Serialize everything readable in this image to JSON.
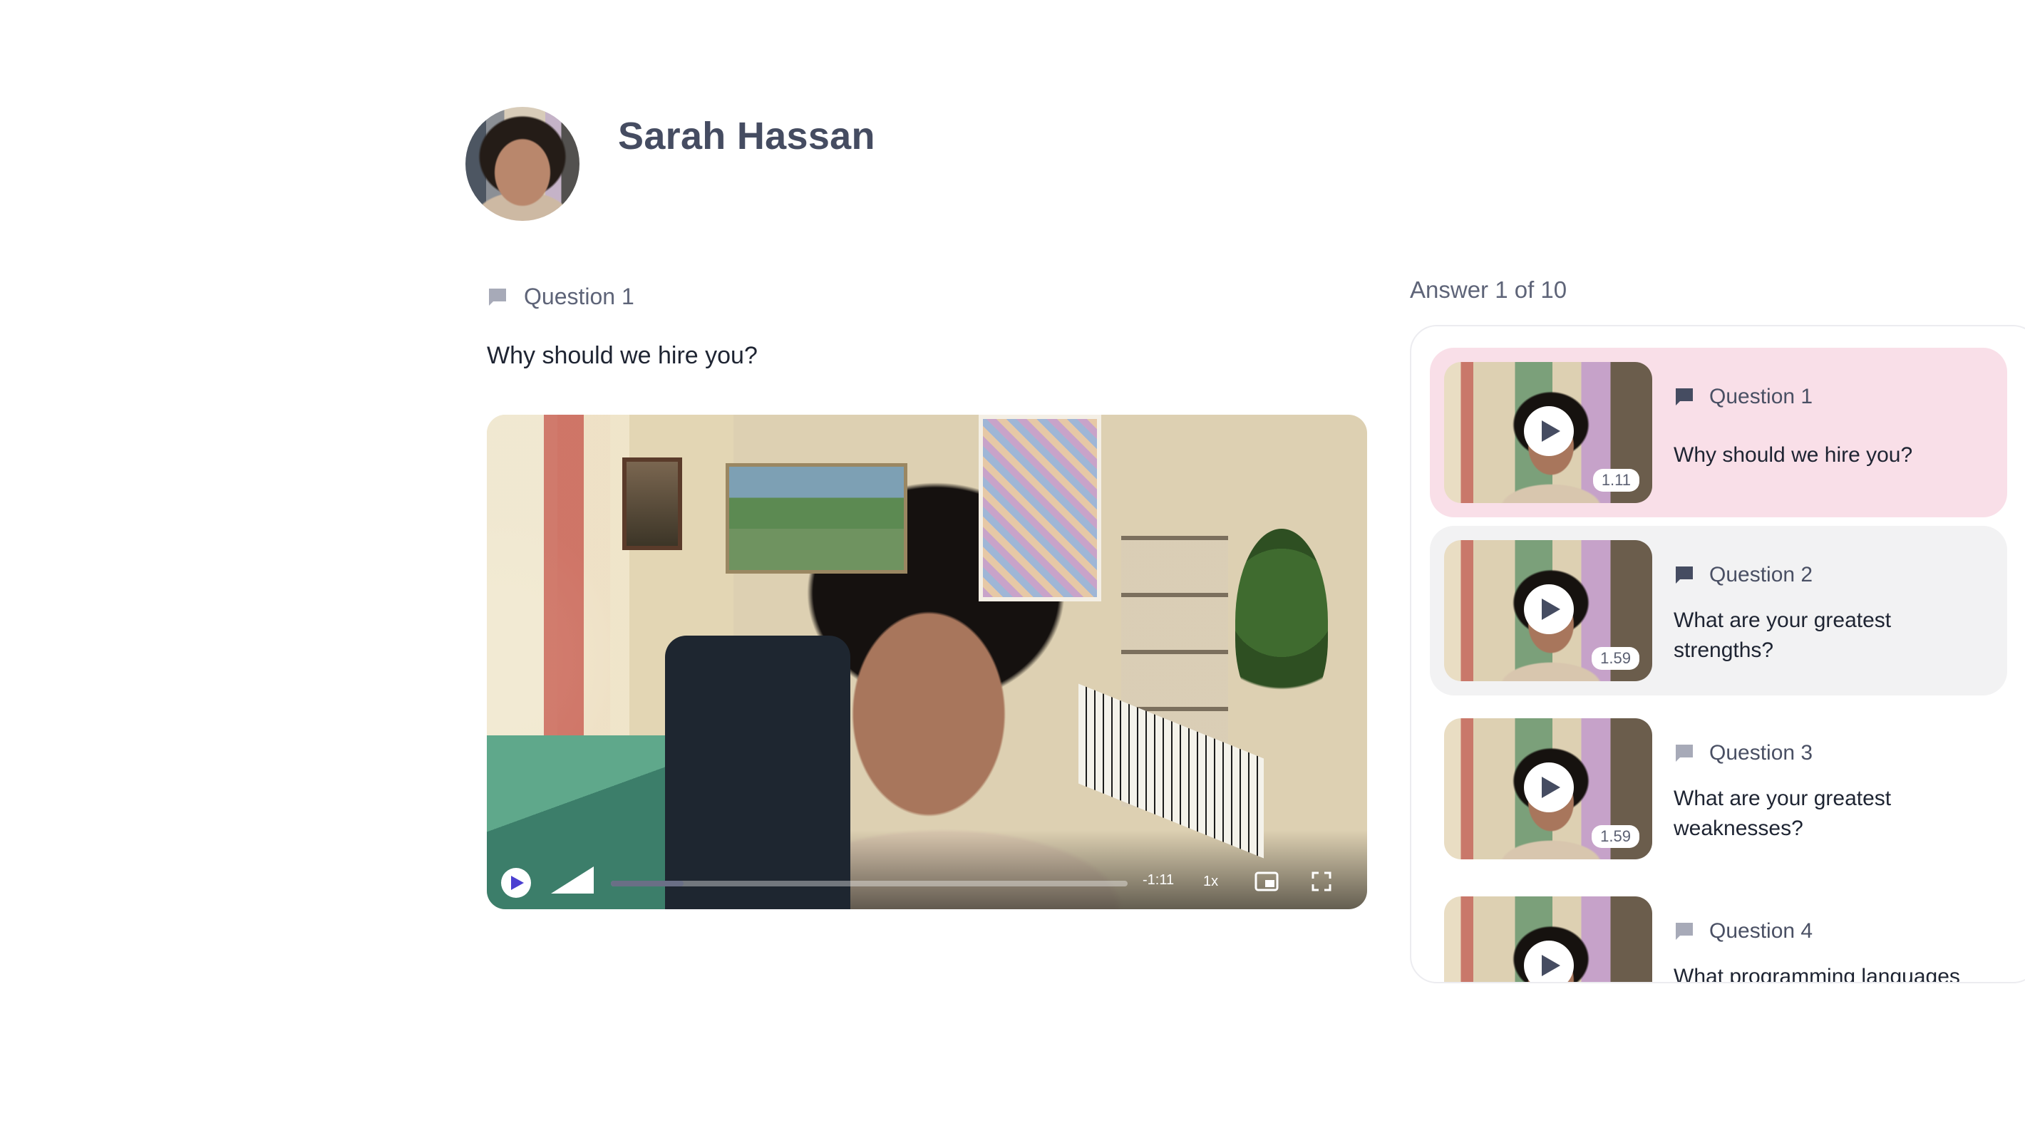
{
  "candidate": {
    "name": "Sarah Hassan"
  },
  "current_question": {
    "label": "Question 1",
    "text": "Why should we hire you?"
  },
  "player": {
    "time_remaining": "-1:11",
    "speed": "1x",
    "progress_fraction": 0.14
  },
  "answers": {
    "counter": "Answer 1 of 10",
    "items": [
      {
        "label": "Question 1",
        "text": "Why should we hire you?",
        "duration": "1.11",
        "state": "active"
      },
      {
        "label": "Question 2",
        "text": "What are your greatest strengths?",
        "duration": "1.59",
        "state": "hovered"
      },
      {
        "label": "Question 3",
        "text": "What are your greatest weaknesses?",
        "duration": "1.59",
        "state": "default"
      },
      {
        "label": "Question 4",
        "text": "What programming languages",
        "duration": "",
        "state": "default"
      }
    ]
  },
  "colors": {
    "accent": "#4b3fd1",
    "active_item_bg": "#f9dfe8",
    "hover_item_bg": "#f2f2f3",
    "icon_muted": "#a7aab8",
    "icon_dark": "#454c61"
  },
  "icons": {
    "question": "chat-bubble-icon",
    "play": "play-icon",
    "volume": "volume-icon",
    "pip": "picture-in-picture-icon",
    "fullscreen": "fullscreen-icon"
  }
}
